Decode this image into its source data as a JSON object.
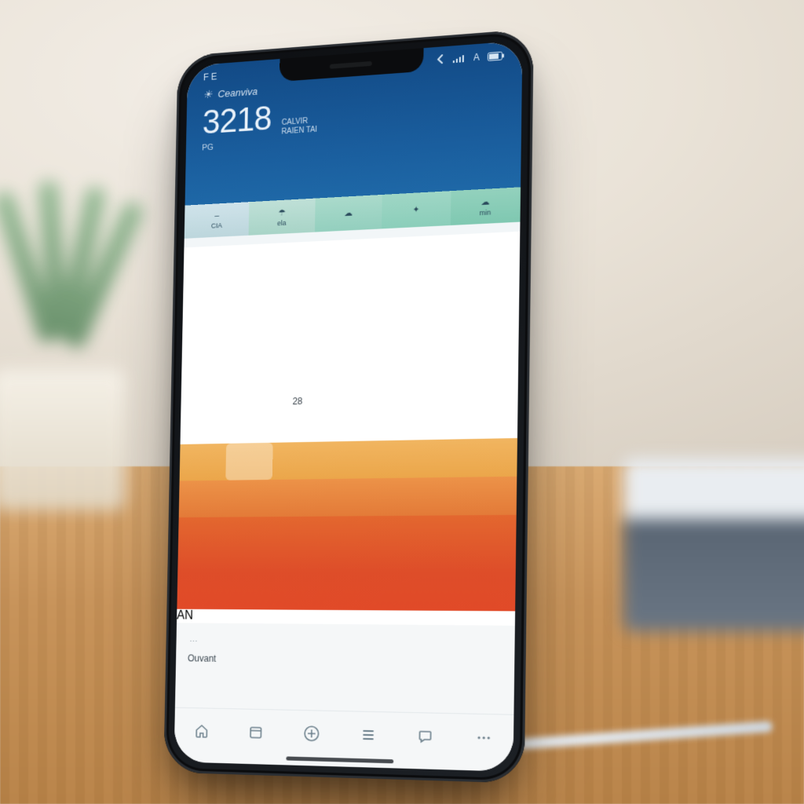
{
  "statusbar": {
    "left": "F E",
    "signal_label": "A"
  },
  "hero": {
    "eyebrow_glyph": "☀",
    "eyebrow_text": "Ceanviva",
    "temp": "3218",
    "sub_line1": "CALVIR",
    "sub_line2": "RAIEN TAI",
    "foot": "PG",
    "chips": [
      {
        "top": "–",
        "bottom": "CIA"
      },
      {
        "top": "☂",
        "bottom": "ela"
      },
      {
        "top": "☁",
        "bottom": ""
      },
      {
        "top": "✦",
        "bottom": ""
      },
      {
        "top": "☁",
        "bottom": "min"
      }
    ]
  },
  "day_labels": [
    "",
    "",
    "",
    "",
    "",
    "",
    ""
  ],
  "grid": {
    "rows": [
      [
        "",
        "",
        "",
        "",
        "",
        "",
        ""
      ],
      [
        "",
        "",
        "",
        "",
        "",
        "",
        ""
      ],
      [
        "",
        "",
        "",
        "",
        "",
        "",
        ""
      ],
      [
        "",
        "",
        "",
        "",
        "",
        "",
        ""
      ],
      [
        "",
        "",
        "28",
        "",
        "",
        "",
        ""
      ]
    ],
    "sub": [
      "",
      "",
      "",
      "",
      "",
      "",
      ""
    ]
  },
  "bands": {
    "amber": [
      "",
      "",
      "",
      "",
      "",
      "",
      ""
    ],
    "orange": [
      "",
      "",
      "",
      "",
      "",
      "",
      ""
    ],
    "red": [
      "",
      "",
      "",
      "",
      "",
      "",
      ""
    ],
    "tag": "AN"
  },
  "panel": {
    "title": "Ouvant",
    "row_items": [
      "",
      "",
      "",
      ""
    ]
  },
  "toolbar": {
    "items": [
      "home",
      "calendar",
      "add",
      "list",
      "chat",
      "menu"
    ]
  },
  "colors": {
    "hero_top": "#124a86",
    "hero_bottom": "#216fad",
    "amber": "#eba64a",
    "orange": "#e37a38",
    "red": "#de4d29"
  }
}
